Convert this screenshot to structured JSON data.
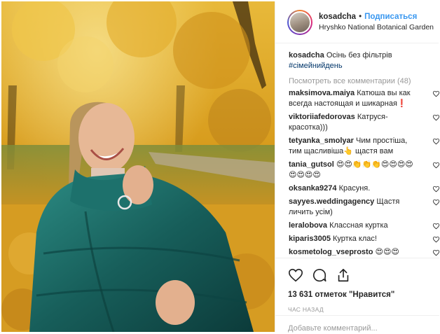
{
  "header": {
    "username": "kosadcha",
    "separator": "•",
    "follow_label": "Подписаться",
    "location": "Hryshko National Botanical Garden"
  },
  "caption": {
    "username": "kosadcha",
    "text": "Осінь без фільтрів",
    "hashtag": "#сімейнийдень"
  },
  "view_all_label": "Посмотреть все комментарии (48)",
  "comments": [
    {
      "username": "maksimova.maiya",
      "text": "Катюша вы как всегда настоящая и шикарная❗"
    },
    {
      "username": "viktoriiafedorovas",
      "text": "Катруся-красотка)))"
    },
    {
      "username": "tetyanka_smolyar",
      "text": "Чим простіша, тим щасливіша👆 щастя вам"
    },
    {
      "username": "tania_gutsol",
      "text": "😍😍👏👏👏😍😍😍😍😍😍😍😍"
    },
    {
      "username": "oksanka9274",
      "text": "Красуня."
    },
    {
      "username": "sayyes.weddingagency",
      "text": "Щастя личить усім)"
    },
    {
      "username": "leralobova",
      "text": "Классная куртка"
    },
    {
      "username": "kiparis3005",
      "text": "Куртка клас!"
    },
    {
      "username": "kosmetolog_vseprosto",
      "text": "😍😍😍"
    }
  ],
  "likes": "13 631 отметок \"Нравится\"",
  "time": "ЧАС НАЗАД",
  "add_comment_placeholder": "Добавьте комментарий...",
  "colors": {
    "link_blue": "#3897f0",
    "hashtag_blue": "#003569",
    "muted_gray": "#999999",
    "text": "#262626",
    "jacket_teal": "#1e6b66",
    "foliage_yellow": "#e2a820"
  },
  "icons": {
    "like": "heart-icon",
    "comment": "comment-bubble-icon",
    "share": "share-icon",
    "comment_like": "heart-icon"
  }
}
